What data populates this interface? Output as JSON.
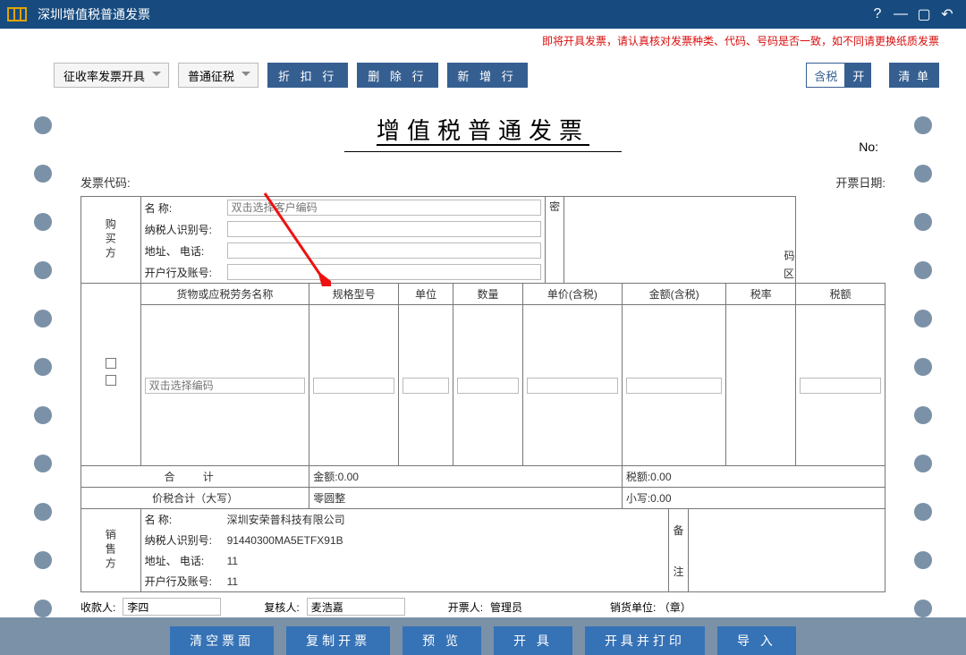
{
  "titlebar": {
    "title": "深圳增值税普通发票"
  },
  "warning": "即将开具发票，请认真核对发票种类、代码、号码是否一致，如不同请更换纸质发票",
  "toolbar": {
    "dropdown1": "征收率发票开具",
    "dropdown2": "普通征税",
    "discount_row": "折 扣 行",
    "delete_row": "删 除 行",
    "add_row": "新 增 行",
    "tax_label": "含税",
    "tax_switch": "开",
    "qingdan": "清  单"
  },
  "invoice": {
    "title": "增值税普通发票",
    "no_label": "No:",
    "code_label": "发票代码:",
    "date_label": "开票日期:"
  },
  "buyer": {
    "section": "购买方",
    "name_label": "名        称:",
    "name_placeholder": "双击选择客户编码",
    "taxid_label": "纳税人识别号:",
    "addr_label": "地址、  电话:",
    "bank_label": "开户行及账号:",
    "right_labels": [
      "密",
      "码",
      "区"
    ]
  },
  "items": {
    "checkbox_col": "",
    "headers": [
      "货物或应税劳务名称",
      "规格型号",
      "单位",
      "数量",
      "单价(含税)",
      "金额(含税)",
      "税率",
      "税额"
    ],
    "row_placeholder": "双击选择编码"
  },
  "sum": {
    "heji": "合     计",
    "amount_label": "金额:",
    "amount_value": "0.00",
    "tax_label": "税额:",
    "tax_value": "0.00"
  },
  "pricetax": {
    "label": "价税合计（大写）",
    "caps_value": "零圆整",
    "lower_label": "小写:",
    "lower_value": "0.00"
  },
  "seller": {
    "section": "销售方",
    "name_label": "名        称:",
    "name_value": "深圳安荣普科技有限公司",
    "taxid_label": "纳税人识别号:",
    "taxid_value": "91440300MA5ETFX91B",
    "addr_label": "地址、  电话:",
    "addr_value": "11",
    "bank_label": "开户行及账号:",
    "bank_value": "11",
    "right_top": "备",
    "right_bottom": "注"
  },
  "footer": {
    "payee_label": "收款人:",
    "payee_value": "李四",
    "reviewer_label": "复核人:",
    "reviewer_value": "麦浩嘉",
    "drawer_label": "开票人:",
    "drawer_value": "管理员",
    "seller_unit": "销货单位:  （章）"
  },
  "actions": {
    "clear": "清空票面",
    "copy": "复制开票",
    "preview": "预  览",
    "issue": "开  具",
    "issue_print": "开具并打印",
    "import": "导  入"
  }
}
